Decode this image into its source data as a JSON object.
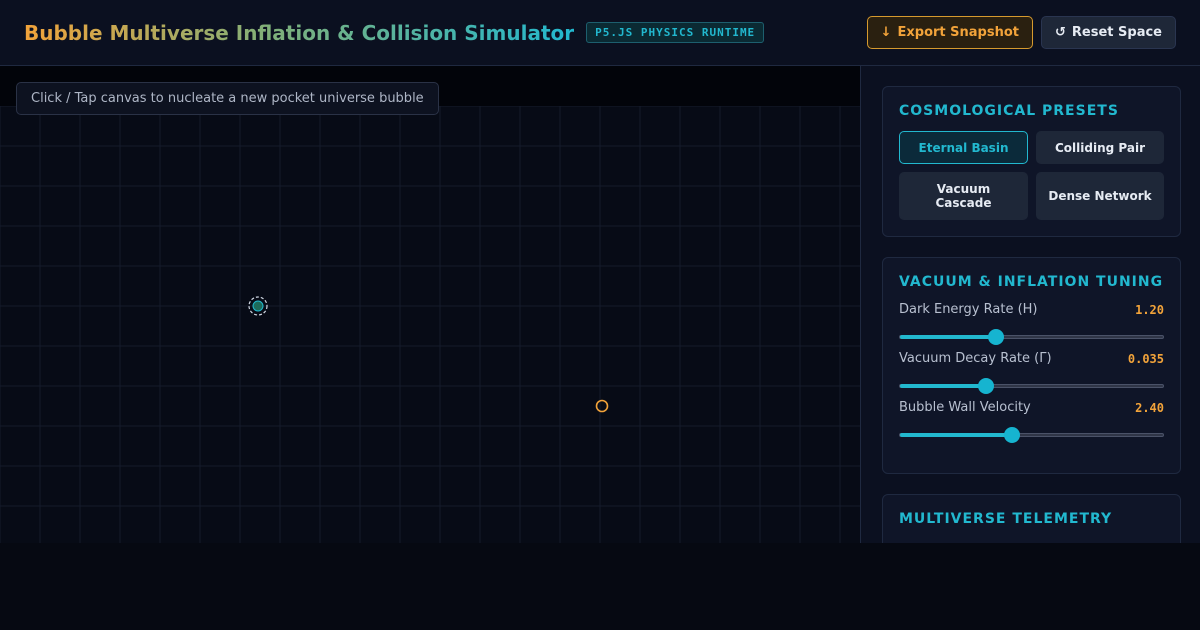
{
  "header": {
    "title": "Bubble Multiverse Inflation & Collision Simulator",
    "badge": "P5.JS PHYSICS RUNTIME",
    "export_icon": "↓",
    "export_label": "Export Snapshot",
    "reset_icon": "↺",
    "reset_label": "Reset Space"
  },
  "canvas": {
    "hint": "Click / Tap canvas to nucleate a new pocket universe bubble"
  },
  "presets": {
    "title": "Cosmological Presets",
    "items": [
      {
        "label": "Eternal Basin",
        "active": true
      },
      {
        "label": "Colliding Pair",
        "active": false
      },
      {
        "label": "Vacuum Cascade",
        "active": false
      },
      {
        "label": "Dense Network",
        "active": false
      }
    ]
  },
  "tuning": {
    "title": "Vacuum & Inflation Tuning",
    "sliders": [
      {
        "label": "Dark Energy Rate (H)",
        "value": "1.20",
        "fraction": 0.365
      },
      {
        "label": "Vacuum Decay Rate (Γ)",
        "value": "0.035",
        "fraction": 0.328
      },
      {
        "label": "Bubble Wall Velocity",
        "value": "2.40",
        "fraction": 0.425
      }
    ]
  },
  "telemetry": {
    "title": "Multiverse Telemetry"
  },
  "colors": {
    "accent": "#22b8cf",
    "warm": "#f2a33a"
  }
}
